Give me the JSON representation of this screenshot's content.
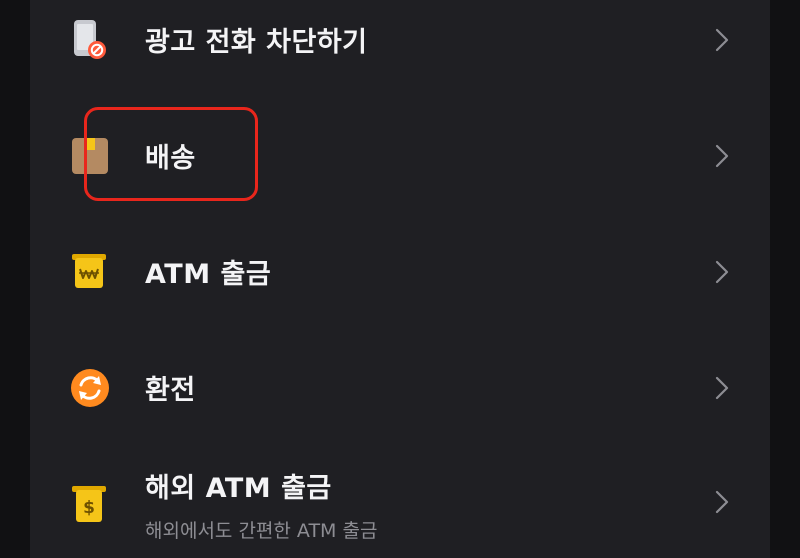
{
  "menu": {
    "items": [
      {
        "id": "block-ad-calls",
        "label": "광고 전화 차단하기",
        "icon": "phone-block-icon"
      },
      {
        "id": "delivery",
        "label": "배송",
        "icon": "box-icon",
        "highlighted": true
      },
      {
        "id": "atm-withdraw",
        "label": "ATM 출금",
        "icon": "atm-won-icon"
      },
      {
        "id": "exchange",
        "label": "환전",
        "icon": "exchange-icon"
      },
      {
        "id": "overseas-atm",
        "label": "해외 ATM 출금",
        "sublabel": "해외에서도 간편한 ATM 출금",
        "icon": "atm-dollar-icon"
      }
    ]
  },
  "colors": {
    "background": "#1f1f23",
    "highlight": "#e8261c",
    "accent_yellow": "#f5c518",
    "accent_orange": "#ff8a1f"
  }
}
